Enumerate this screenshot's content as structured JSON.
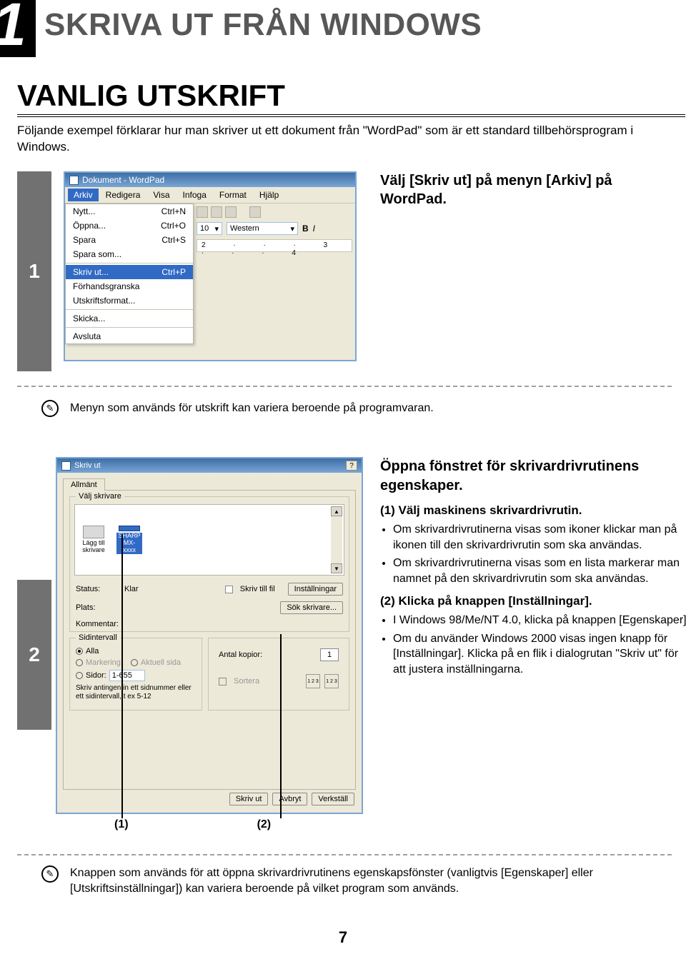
{
  "chapter": {
    "number": "1",
    "title": "SKRIVA UT FRÅN WINDOWS"
  },
  "section": {
    "heading": "VANLIG UTSKRIFT",
    "intro": "Följande exempel förklarar hur man skriver ut ett dokument från \"WordPad\" som är ett standard tillbehörsprogram i Windows."
  },
  "step1": {
    "number": "1",
    "instruction": "Välj [Skriv ut] på menyn [Arkiv] på WordPad.",
    "wordpad": {
      "title": "Dokument - WordPad",
      "menu": [
        "Arkiv",
        "Redigera",
        "Visa",
        "Infoga",
        "Format",
        "Hjälp"
      ],
      "dropdown": [
        {
          "l": "Nytt...",
          "s": "Ctrl+N"
        },
        {
          "l": "Öppna...",
          "s": "Ctrl+O"
        },
        {
          "l": "Spara",
          "s": "Ctrl+S"
        },
        {
          "l": "Spara som...",
          "s": ""
        }
      ],
      "dropdown_sel": {
        "l": "Skriv ut...",
        "s": "Ctrl+P"
      },
      "dropdown2": [
        "Förhandsgranska",
        "Utskriftsformat..."
      ],
      "dropdown3": "Skicka...",
      "dropdown4": "Avsluta",
      "fontsize": "10",
      "fontname": "Western",
      "ruler": "2 · · · 3 · · · 4"
    },
    "note": "Menyn som används för utskrift kan variera beroende på programvaran."
  },
  "step2": {
    "number": "2",
    "dialog": {
      "title": "Skriv ut",
      "tab": "Allmänt",
      "group1": "Välj skrivare",
      "addprinter": "Lägg till skrivare",
      "printer": "SHARP MX-xxxx",
      "status_l": "Status:",
      "status_v": "Klar",
      "plats_l": "Plats:",
      "kommentar_l": "Kommentar:",
      "tofile": "Skriv till fil",
      "btn_settings": "Inställningar",
      "btn_find": "Sök skrivare...",
      "group2": "Sidintervall",
      "r_all": "Alla",
      "r_mark": "Markering",
      "r_aktuell": "Aktuell sida",
      "r_sidor": "Sidor:",
      "sidor_val": "1-655",
      "helptext": "Skriv antingen in ett sidnummer eller ett sidintervall, t ex 5-12",
      "copies_l": "Antal kopior:",
      "copies_v": "1",
      "sortera": "Sortera",
      "btn_print": "Skriv ut",
      "btn_cancel": "Avbryt",
      "btn_apply": "Verkställ"
    },
    "instruction": {
      "heading": "Öppna fönstret för skrivardrivrutinens egenskaper.",
      "p1_title": "(1)  Välj maskinens skrivardrivrutin.",
      "p1_b1": "Om skrivardrivrutinerna visas som ikoner klickar man på ikonen till den skrivardrivrutin som ska användas.",
      "p1_b2": "Om skrivardrivrutinerna visas som en lista markerar man namnet på den skrivardrivrutin som ska användas.",
      "p2_title": "(2)  Klicka på knappen [Inställningar].",
      "p2_b1": "I Windows 98/Me/NT 4.0, klicka på knappen [Egenskaper].",
      "p2_b2": "Om du använder Windows 2000 visas ingen knapp för [Inställningar]. Klicka på en flik i dialogrutan \"Skriv ut\" för att justera inställningarna."
    },
    "callouts": {
      "c1": "(1)",
      "c2": "(2)"
    },
    "note": "Knappen som används för att öppna skrivardrivrutinens egenskapsfönster (vanligtvis [Egenskaper] eller [Utskriftsinställningar]) kan variera beroende på vilket program som används."
  },
  "pagenum": "7"
}
